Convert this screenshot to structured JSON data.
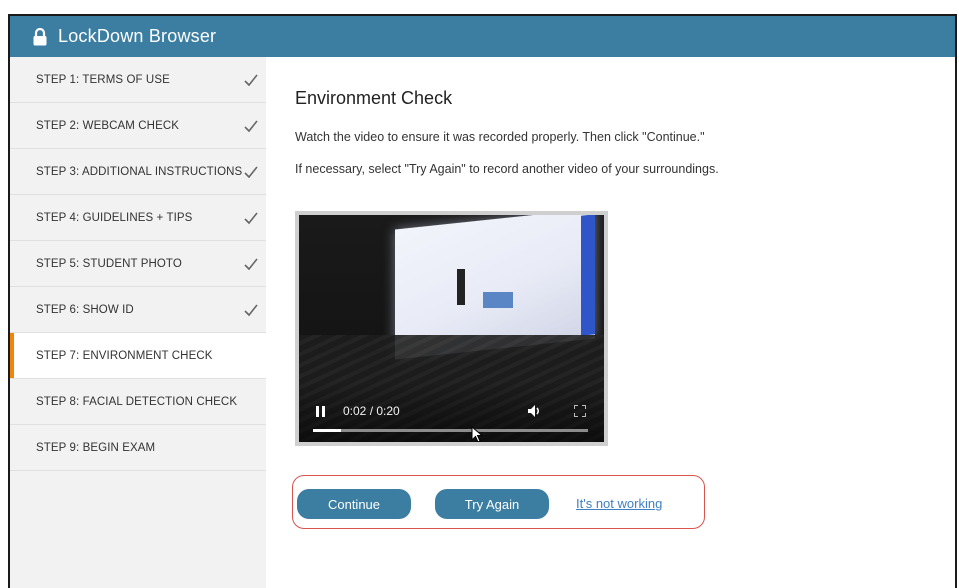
{
  "app": {
    "title": "LockDown Browser",
    "accent_color": "#3b7ea1",
    "active_indicator_color": "#f0850a"
  },
  "sidebar": {
    "items": [
      {
        "label": "STEP 1: TERMS OF USE",
        "completed": true,
        "active": false
      },
      {
        "label": "STEP 2: WEBCAM CHECK",
        "completed": true,
        "active": false
      },
      {
        "label": "STEP 3: ADDITIONAL INSTRUCTIONS",
        "completed": true,
        "active": false
      },
      {
        "label": "STEP 4: GUIDELINES + TIPS",
        "completed": true,
        "active": false
      },
      {
        "label": "STEP 5: STUDENT PHOTO",
        "completed": true,
        "active": false
      },
      {
        "label": "STEP 6: SHOW ID",
        "completed": true,
        "active": false
      },
      {
        "label": "STEP 7: ENVIRONMENT CHECK",
        "completed": false,
        "active": true
      },
      {
        "label": "STEP 8: FACIAL DETECTION CHECK",
        "completed": false,
        "active": false
      },
      {
        "label": "STEP 9: BEGIN EXAM",
        "completed": false,
        "active": false
      }
    ]
  },
  "main": {
    "heading": "Environment Check",
    "instruction_1": "Watch the video to ensure it was recorded properly. Then click \"Continue.\"",
    "instruction_2": "If necessary, select \"Try Again\" to record another video of your surroundings.",
    "video": {
      "time_display": "0:02 / 0:20",
      "progress_fraction": 0.1,
      "state": "playing"
    },
    "buttons": {
      "continue_label": "Continue",
      "try_again_label": "Try Again",
      "not_working_label": "It's not working",
      "highlight_color": "#d9534f"
    }
  }
}
